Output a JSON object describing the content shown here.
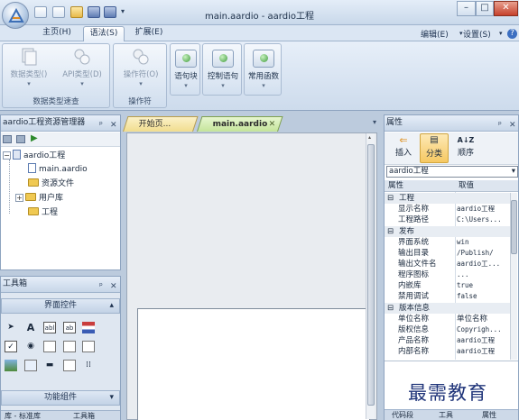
{
  "window": {
    "title": "main.aardio - aardio工程",
    "minimize": "–",
    "maximize": "□",
    "close": "✕"
  },
  "ribbon_tabs": {
    "home": "主页(H)",
    "syntax": "语法(S)",
    "extend": "扩展(E)",
    "edit": "编辑(E)",
    "settings": "设置(S)",
    "help": "?"
  },
  "ribbon": {
    "group1": {
      "label": "数据类型速查",
      "buttons": [
        "数据类型()",
        "API类型(D)"
      ]
    },
    "group2": {
      "label": "操作符",
      "buttons": [
        "操作符(O)"
      ]
    },
    "buttons_green": [
      "语句块",
      "控制语句",
      "常用函数"
    ]
  },
  "resource_panel": {
    "title": "aardio工程资源管理器",
    "tree": [
      {
        "label": "aardio工程"
      },
      {
        "label": "main.aardio"
      },
      {
        "label": "资源文件"
      },
      {
        "label": "用户库"
      },
      {
        "label": "工程"
      }
    ]
  },
  "toolbox": {
    "title": "工具箱",
    "section1": "界面控件",
    "section2": "功能组件",
    "icon_row1": [
      "arrow-cursor-icon",
      "A",
      "abl",
      "ab",
      "flag-icon"
    ],
    "bottom_tabs": [
      "库 - 标准库",
      "工具箱"
    ]
  },
  "doc_tabs": {
    "start": "开始页...",
    "main": "main.aardio"
  },
  "properties": {
    "title": "属性",
    "toolbar": [
      "插入",
      "分类",
      "顺序"
    ],
    "object_select": "aardio工程",
    "col_name": "属性",
    "col_value": "取值",
    "categories": [
      {
        "name": "工程",
        "rows": [
          {
            "k": "显示名称",
            "v": "aardio工程"
          },
          {
            "k": "工程路径",
            "v": "C:\\Users..."
          }
        ]
      },
      {
        "name": "发布",
        "rows": [
          {
            "k": "界面系统",
            "v": "win"
          },
          {
            "k": "输出目录",
            "v": "/Publish/"
          },
          {
            "k": "输出文件名",
            "v": "aardio工..."
          },
          {
            "k": "程序图标",
            "v": "..."
          },
          {
            "k": "内嵌库",
            "v": "true"
          },
          {
            "k": "禁用调试",
            "v": "false"
          }
        ]
      },
      {
        "name": "版本信息",
        "rows": [
          {
            "k": "单位名称",
            "v": "单位名称"
          },
          {
            "k": "版权信息",
            "v": "Copyrigh..."
          },
          {
            "k": "产品名称",
            "v": "aardio工程"
          },
          {
            "k": "内部名称",
            "v": "aardio工程"
          }
        ]
      }
    ],
    "bottom_tabs": [
      "代码段",
      "工具",
      "属性"
    ]
  },
  "watermark": "最需教育",
  "colors": {
    "frame": "#bccbdd",
    "ribbon": "#dbe6f3",
    "active_doc_tab": "#cfe7a8",
    "start_tab": "#f6e6a6",
    "watermark": "#20357a"
  }
}
